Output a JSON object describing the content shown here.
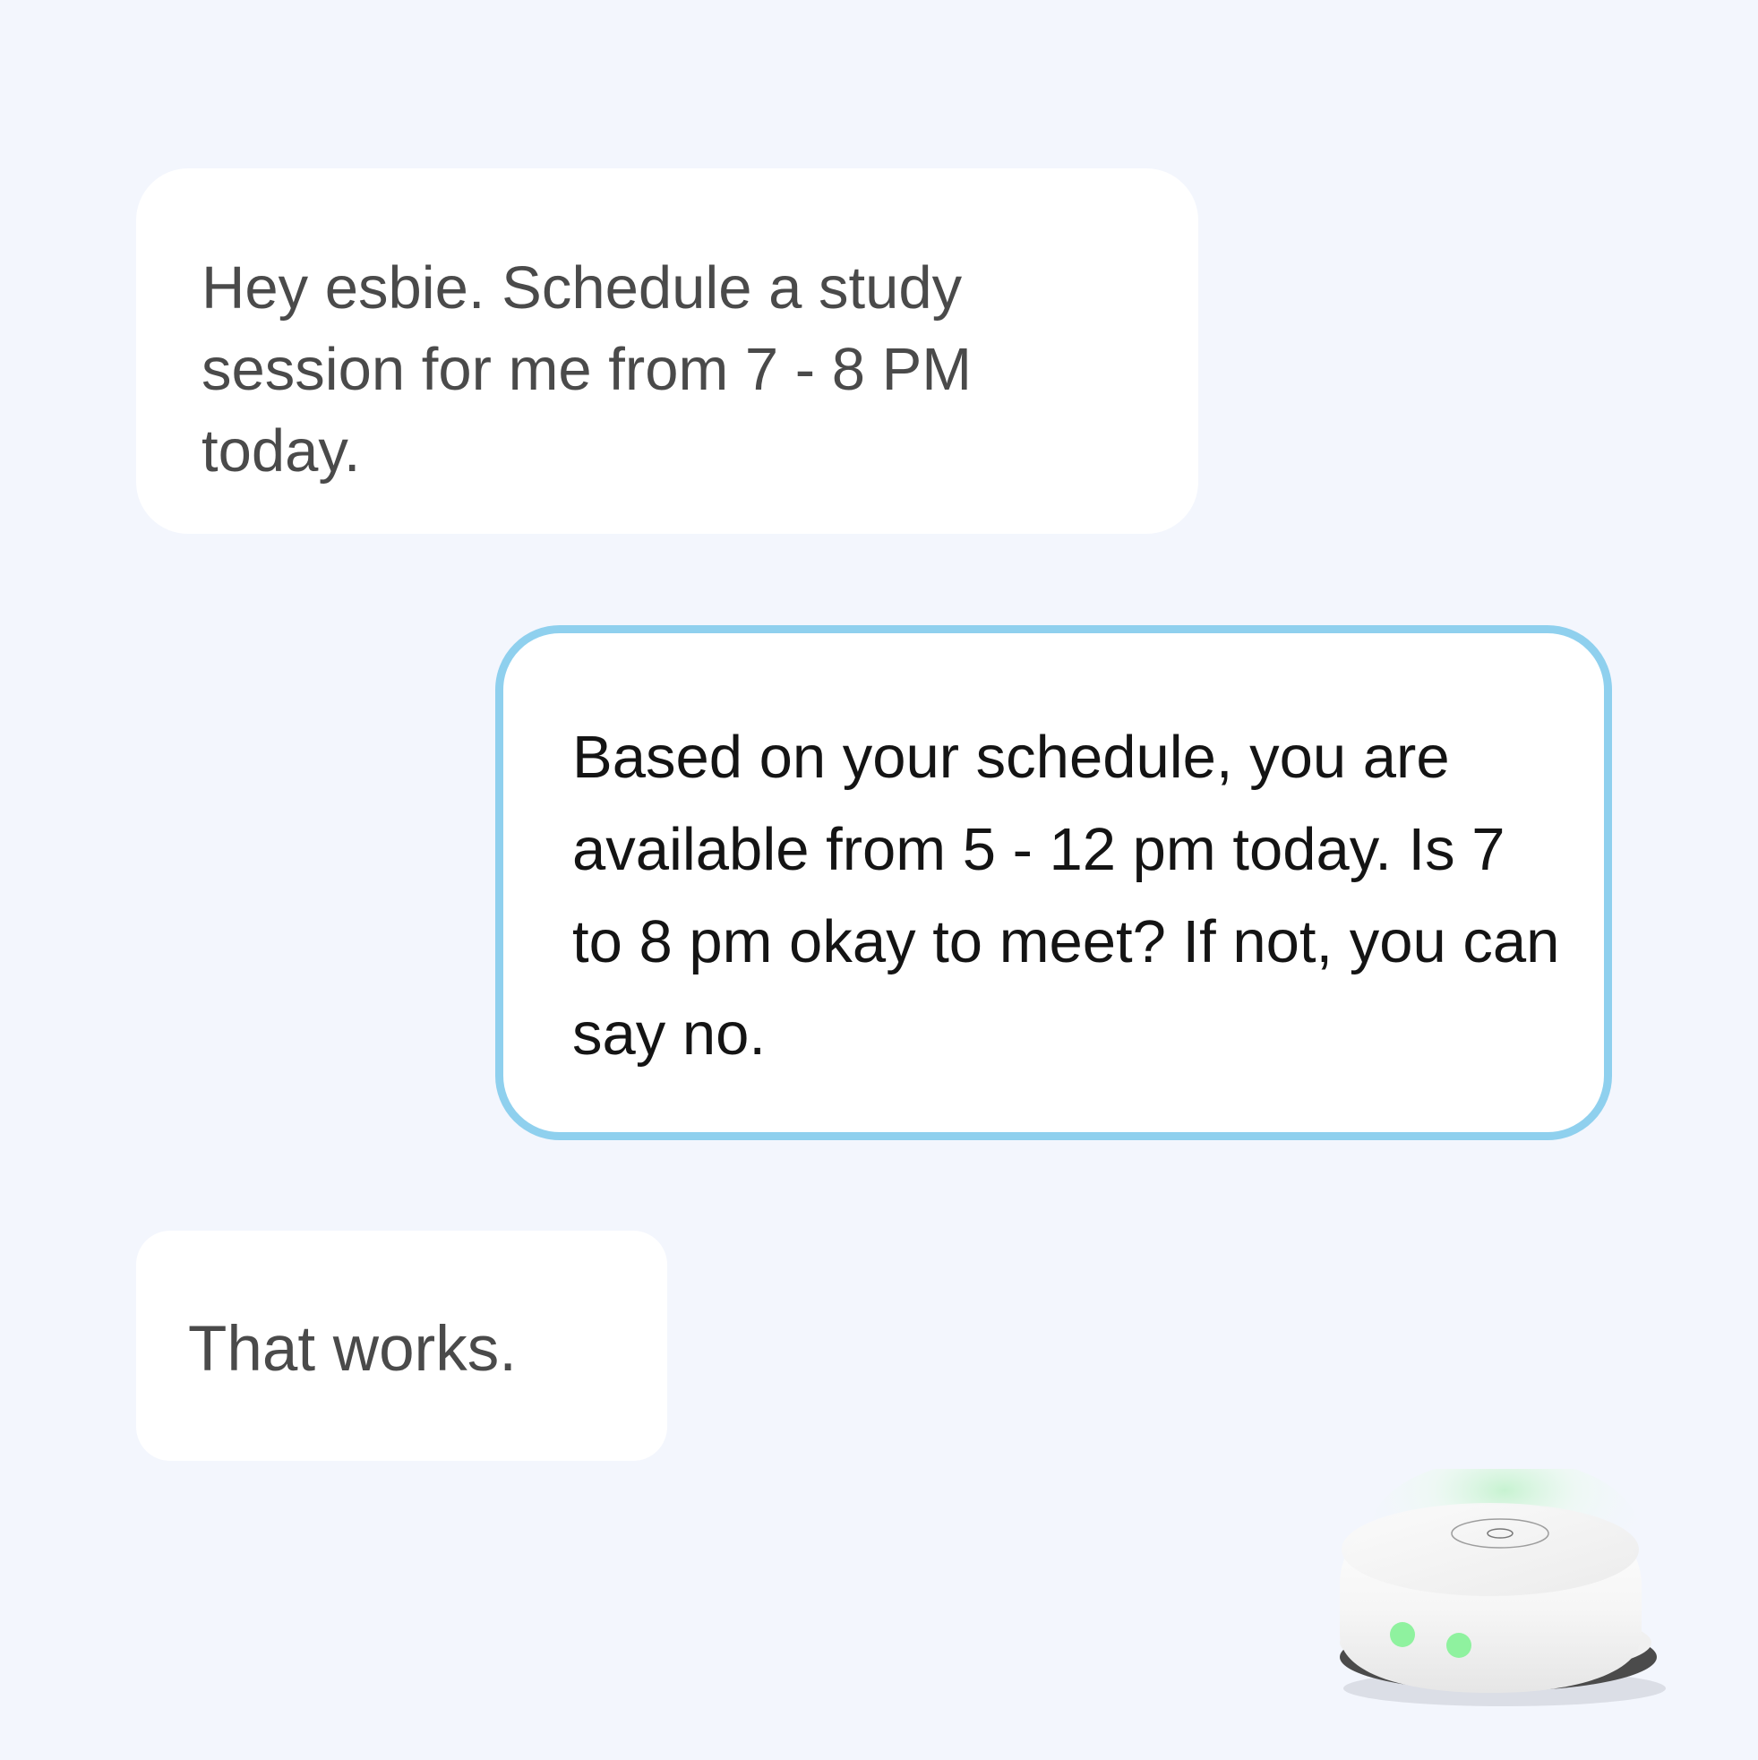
{
  "conversation": {
    "messages": [
      {
        "role": "user",
        "text": "Hey esbie. Schedule a study session for me from 7 - 8 PM today."
      },
      {
        "role": "assistant",
        "text": "Based on your schedule, you are available from 5 - 12 pm today. Is 7 to 8 pm okay to meet? If not, you can say no."
      },
      {
        "role": "user",
        "text": "That works."
      }
    ]
  },
  "device": {
    "icon": "smart-speaker-icon",
    "indicator_color": "#8ff29f",
    "highlight_color": "#8fd0ee"
  }
}
